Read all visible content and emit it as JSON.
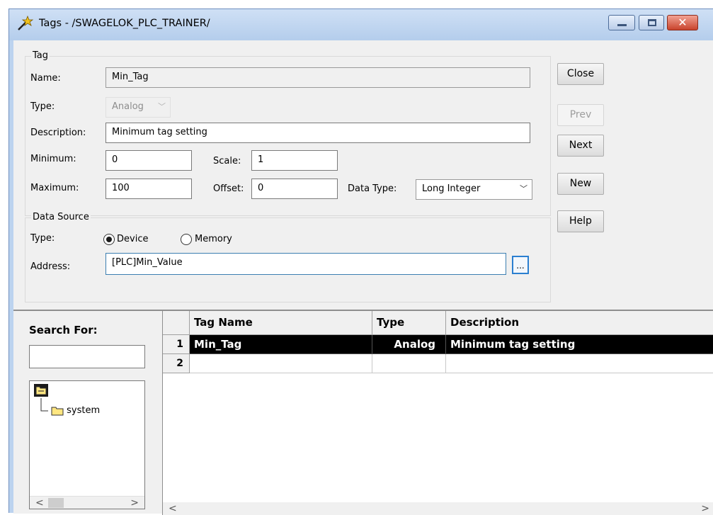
{
  "window": {
    "title": "Tags - /SWAGELOK_PLC_TRAINER/",
    "close_glyph": "✕"
  },
  "tag": {
    "group_title": "Tag",
    "name_label": "Name:",
    "name_value": "Min_Tag",
    "type_label": "Type:",
    "type_value": "Analog",
    "description_label": "Description:",
    "description_value": "Minimum tag setting",
    "minimum_label": "Minimum:",
    "minimum_value": "0",
    "scale_label": "Scale:",
    "scale_value": "1",
    "maximum_label": "Maximum:",
    "maximum_value": "100",
    "offset_label": "Offset:",
    "offset_value": "0",
    "data_type_label": "Data Type:",
    "data_type_value": "Long Integer"
  },
  "data_source": {
    "group_title": "Data Source",
    "type_label": "Type:",
    "device_label": "Device",
    "memory_label": "Memory",
    "selected": "Device",
    "address_label": "Address:",
    "address_value": "[PLC]Min_Value",
    "browse_label": "..."
  },
  "buttons": {
    "close": "Close",
    "prev": "Prev",
    "next": "Next",
    "new": "New",
    "help": "Help"
  },
  "search": {
    "label": "Search For:",
    "value": "",
    "tree": [
      {
        "label": "",
        "icon": "folder-open-icon"
      },
      {
        "label": "system",
        "icon": "folder-icon"
      }
    ]
  },
  "grid": {
    "columns": [
      "Tag Name",
      "Type",
      "Description"
    ],
    "rows": [
      {
        "num": "1",
        "tag_name": "Min_Tag",
        "type": "Analog",
        "description": "Minimum tag setting",
        "selected": true
      },
      {
        "num": "2",
        "tag_name": "",
        "type": "",
        "description": "",
        "selected": false
      }
    ]
  },
  "scroll": {
    "left": "<",
    "right": ">"
  },
  "colors": {
    "title_bar": "#bcd3ef",
    "close_button": "#c8432c",
    "selection": "#000000",
    "folder": "#ffe680"
  }
}
